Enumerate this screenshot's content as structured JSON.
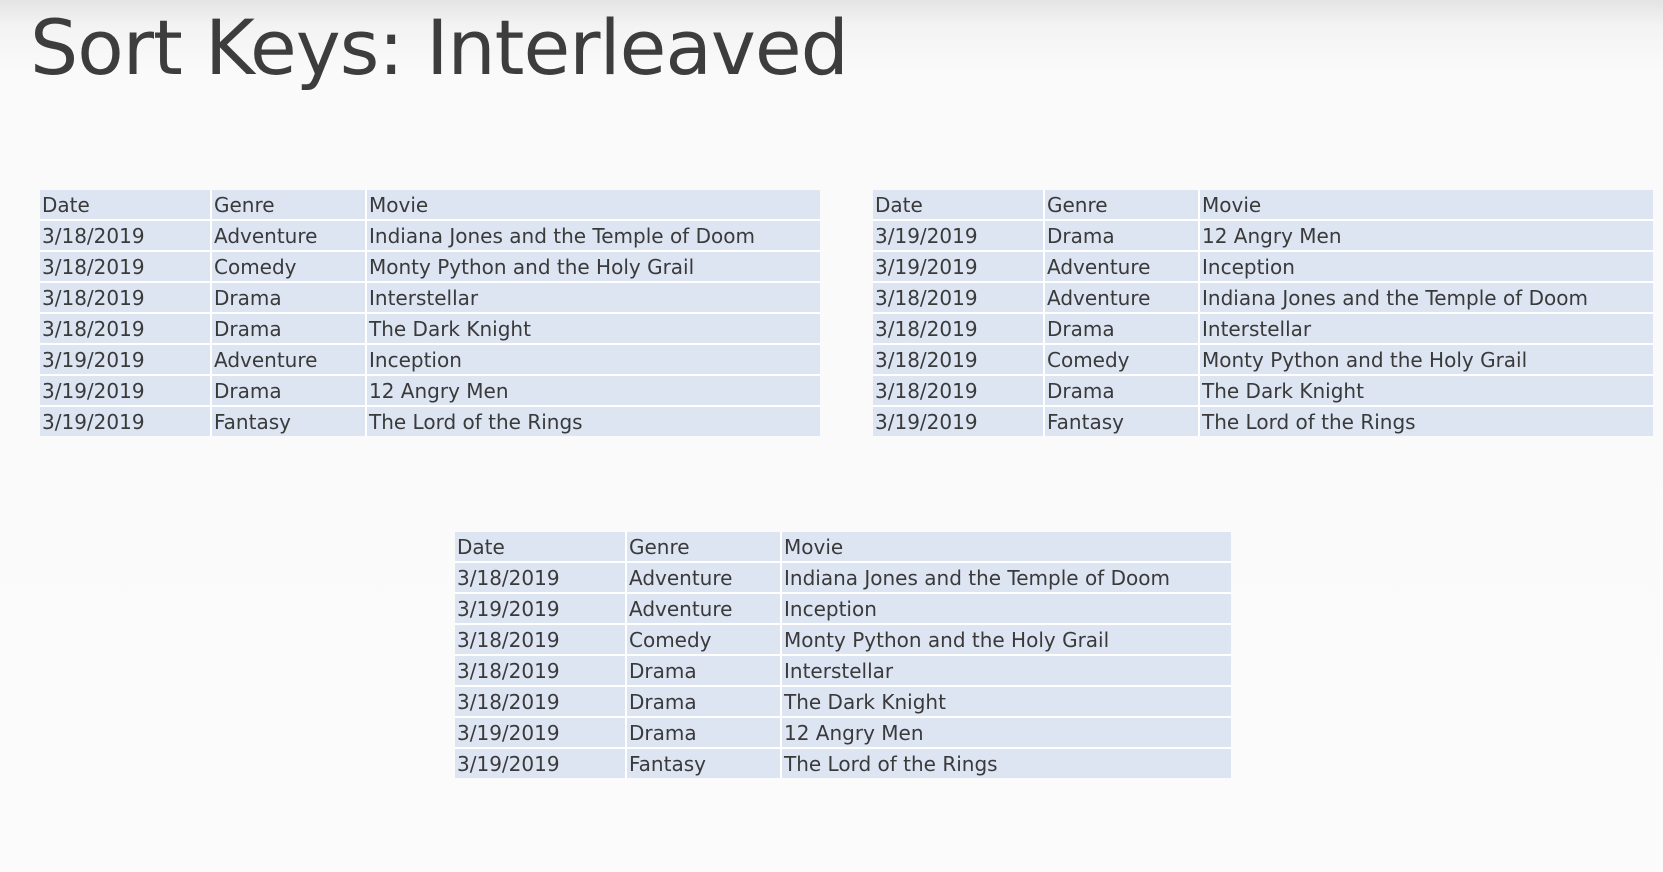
{
  "title": "Sort Keys: Interleaved",
  "tables": [
    {
      "headers": [
        "Date",
        "Genre",
        "Movie"
      ],
      "rows": [
        [
          "3/18/2019",
          "Adventure",
          "Indiana Jones and the Temple of Doom"
        ],
        [
          "3/18/2019",
          "Comedy",
          "Monty Python and the Holy Grail"
        ],
        [
          "3/18/2019",
          "Drama",
          "Interstellar"
        ],
        [
          "3/18/2019",
          "Drama",
          "The Dark Knight"
        ],
        [
          "3/19/2019",
          "Adventure",
          "Inception"
        ],
        [
          "3/19/2019",
          "Drama",
          "12 Angry Men"
        ],
        [
          "3/19/2019",
          "Fantasy",
          "The Lord of the Rings"
        ]
      ]
    },
    {
      "headers": [
        "Date",
        "Genre",
        "Movie"
      ],
      "rows": [
        [
          "3/19/2019",
          "Drama",
          "12 Angry Men"
        ],
        [
          "3/19/2019",
          "Adventure",
          "Inception"
        ],
        [
          "3/18/2019",
          "Adventure",
          "Indiana Jones and the Temple of Doom"
        ],
        [
          "3/18/2019",
          "Drama",
          "Interstellar"
        ],
        [
          "3/18/2019",
          "Comedy",
          "Monty Python and the Holy Grail"
        ],
        [
          "3/18/2019",
          "Drama",
          "The Dark Knight"
        ],
        [
          "3/19/2019",
          "Fantasy",
          "The Lord of the Rings"
        ]
      ]
    },
    {
      "headers": [
        "Date",
        "Genre",
        "Movie"
      ],
      "rows": [
        [
          "3/18/2019",
          "Adventure",
          "Indiana Jones and the Temple of Doom"
        ],
        [
          "3/19/2019",
          "Adventure",
          "Inception"
        ],
        [
          "3/18/2019",
          "Comedy",
          "Monty Python and the Holy Grail"
        ],
        [
          "3/18/2019",
          "Drama",
          "Interstellar"
        ],
        [
          "3/18/2019",
          "Drama",
          "The Dark Knight"
        ],
        [
          "3/19/2019",
          "Drama",
          "12 Angry Men"
        ],
        [
          "3/19/2019",
          "Fantasy",
          "The Lord of the Rings"
        ]
      ]
    }
  ]
}
